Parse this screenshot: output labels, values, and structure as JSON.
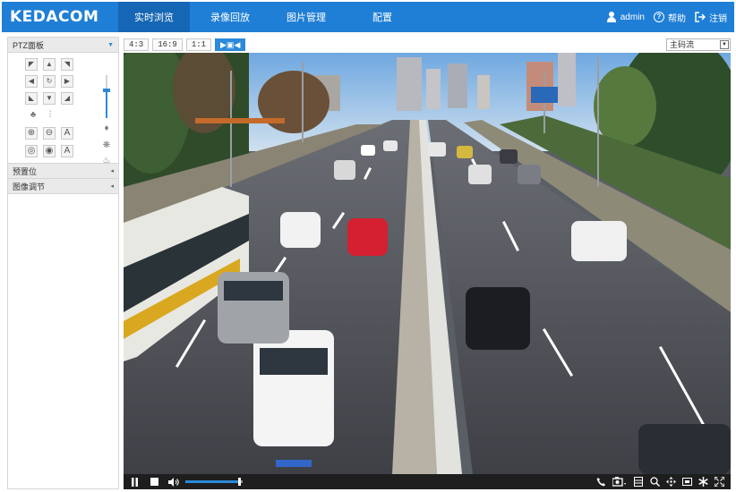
{
  "header": {
    "logo": "KEDACOM",
    "tabs": [
      {
        "label": "实时浏览",
        "active": true
      },
      {
        "label": "录像回放",
        "active": false
      },
      {
        "label": "图片管理",
        "active": false
      },
      {
        "label": "配置",
        "active": false
      }
    ],
    "user": "admin",
    "help": "帮助",
    "logout": "注销",
    "bar_color": "#1f7fd6"
  },
  "sidebar": {
    "ptz_panel": "PTZ面板",
    "preset": "预置位",
    "image_adjust": "图像调节",
    "ptz_zoom_level": 0.6
  },
  "toolbar": {
    "ratios": [
      "4:3",
      "16:9",
      "1:1"
    ],
    "fit_button": "▶▣◀",
    "stream_select": "主码流"
  },
  "controls": {
    "volume": 0.95
  },
  "icons": {
    "play_pause": "pause-icon",
    "stop": "stop-icon",
    "volume": "volume-icon",
    "call": "phone-icon",
    "snapshot": "camera-icon",
    "record": "film-icon",
    "zoom": "zoom-icon",
    "ptz": "move-icon",
    "area": "area-icon",
    "stabilize": "asterisk-icon",
    "fullscreen": "fullscreen-icon"
  }
}
